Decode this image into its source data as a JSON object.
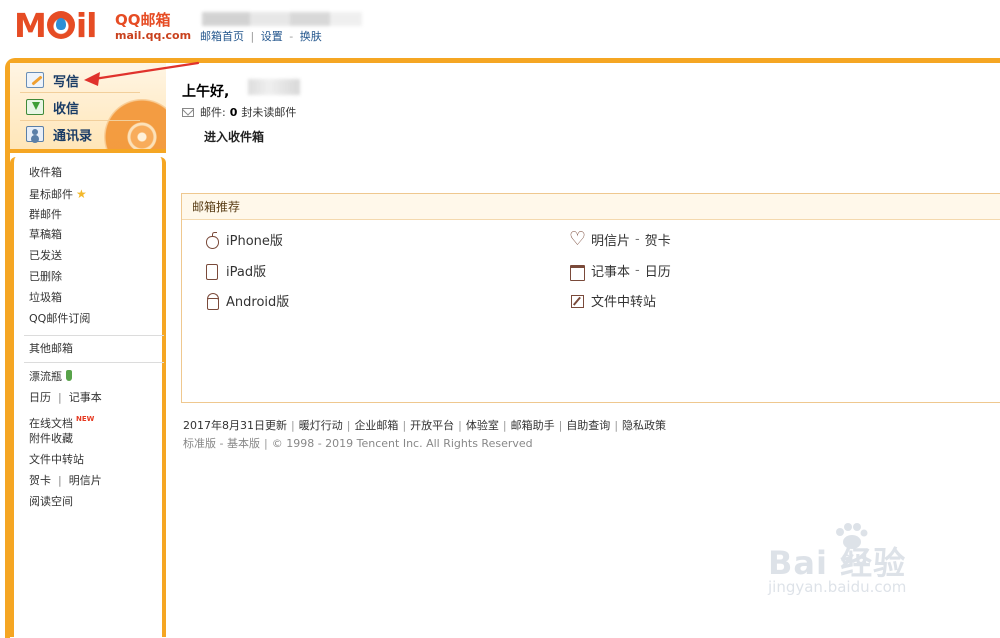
{
  "header": {
    "logo_text_left": "M",
    "logo_text_right": "il",
    "logo_cn": "QQ邮箱",
    "logo_url": "mail.qq.com",
    "links": [
      "邮箱首页",
      "设置",
      "换肤"
    ],
    "separator_bar": "|",
    "separator_dash": "-"
  },
  "sidebar": {
    "actions": [
      {
        "label": "写信",
        "icon": "write-icon"
      },
      {
        "label": "收信",
        "icon": "inbox-icon"
      },
      {
        "label": "通讯录",
        "icon": "contacts-icon"
      }
    ],
    "folders": [
      "收件箱",
      "星标邮件",
      "群邮件",
      "草稿箱",
      "已发送",
      "已删除",
      "垃圾箱",
      "QQ邮件订阅"
    ],
    "other_mailbox": "其他邮箱",
    "apps": {
      "drift_bottle": "漂流瓶",
      "calendar": "日历",
      "notes": "记事本",
      "online_docs": "在线文档",
      "new_badge": "NEW",
      "attachments": "附件收藏",
      "file_transfer": "文件中转站",
      "greeting_card": "贺卡",
      "postcard": "明信片",
      "reading_space": "阅读空间",
      "separator": "|"
    }
  },
  "main": {
    "greeting": "上午好,",
    "mail_label": "邮件:",
    "unread_count": "0",
    "unread_label": "封未读邮件",
    "enter_inbox": "进入收件箱",
    "recommend": {
      "title": "邮箱推荐",
      "left": [
        {
          "label": "iPhone版",
          "icon": "apple-icon"
        },
        {
          "label": "iPad版",
          "icon": "ipad-icon"
        },
        {
          "label": "Android版",
          "icon": "android-icon"
        }
      ],
      "right": [
        {
          "a": "明信片",
          "dash": "-",
          "b": "贺卡",
          "icon": "heart-icon"
        },
        {
          "a": "记事本",
          "dash": "-",
          "b": "日历",
          "icon": "calendar-icon"
        },
        {
          "a": "文件中转站",
          "dash": "",
          "b": "",
          "icon": "file-transfer-icon"
        }
      ]
    },
    "footer": {
      "links": [
        "2017年8月31日更新",
        "暖灯行动",
        "企业邮箱",
        "开放平台",
        "体验室",
        "邮箱助手",
        "自助查询",
        "隐私政策"
      ],
      "line2_links": [
        "标准版",
        "基本版"
      ],
      "copyright": "© 1998 - 2019 Tencent Inc. All Rights Reserved",
      "dash": "-",
      "bar": "|"
    }
  },
  "watermark": {
    "text": "Bai 经验",
    "du": "du",
    "sub": "jingyan.baidu.com"
  },
  "colors": {
    "accent_orange": "#f5a623",
    "logo_red": "#e64c24",
    "link_blue": "#23568d",
    "arrow_red": "#e0322c"
  }
}
